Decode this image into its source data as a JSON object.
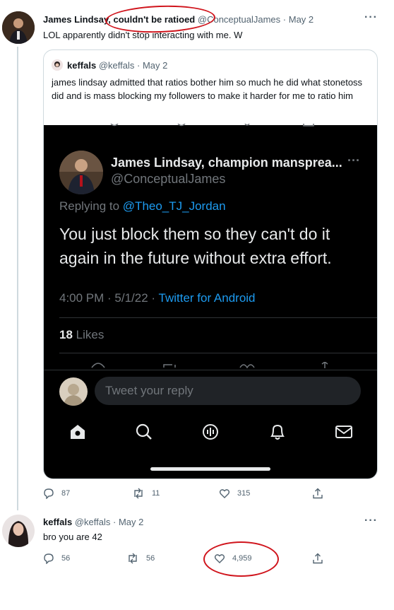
{
  "main_tweet": {
    "author_name": "James Lindsay, couldn't be ratioed",
    "handle": "@ConceptualJames",
    "date": "May 2",
    "text": "LOL apparently didn't stop interacting with me. W",
    "replies": "87",
    "retweets": "11",
    "likes": "315"
  },
  "quoted_tweet": {
    "author_name": "keffals",
    "handle": "@keffals",
    "date": "May 2",
    "text": "james lindsay admitted that ratios bother him so much he did what stonetoss did and is mass blocking my followers to make it harder for me to ratio him"
  },
  "embedded_screenshot": {
    "author_name": "James Lindsay, champion mansprea...",
    "handle": "@ConceptualJames",
    "replying_to_label": "Replying to",
    "replying_to_handle": "@Theo_TJ_Jordan",
    "text": "You just block them so they can't do it again in the future without extra effort.",
    "timestamp": "4:00 PM · 5/1/22 ·",
    "client": "Twitter for Android",
    "likes_count": "18",
    "likes_label": "Likes",
    "reply_placeholder": "Tweet your reply"
  },
  "reply_tweet": {
    "author_name": "keffals",
    "handle": "@keffals",
    "date": "May 2",
    "text": "bro you are 42",
    "replies": "56",
    "retweets": "56",
    "likes": "4,959"
  },
  "icons": [
    "more-icon",
    "reply-icon",
    "retweet-icon",
    "like-icon",
    "share-icon",
    "home-icon",
    "search-icon",
    "spaces-icon",
    "notifications-icon",
    "messages-icon"
  ],
  "colors": {
    "link_blue": "#1d9bf0",
    "annotation_red": "#d0141c",
    "muted_gray": "#536471",
    "dark_bg": "#000000"
  }
}
